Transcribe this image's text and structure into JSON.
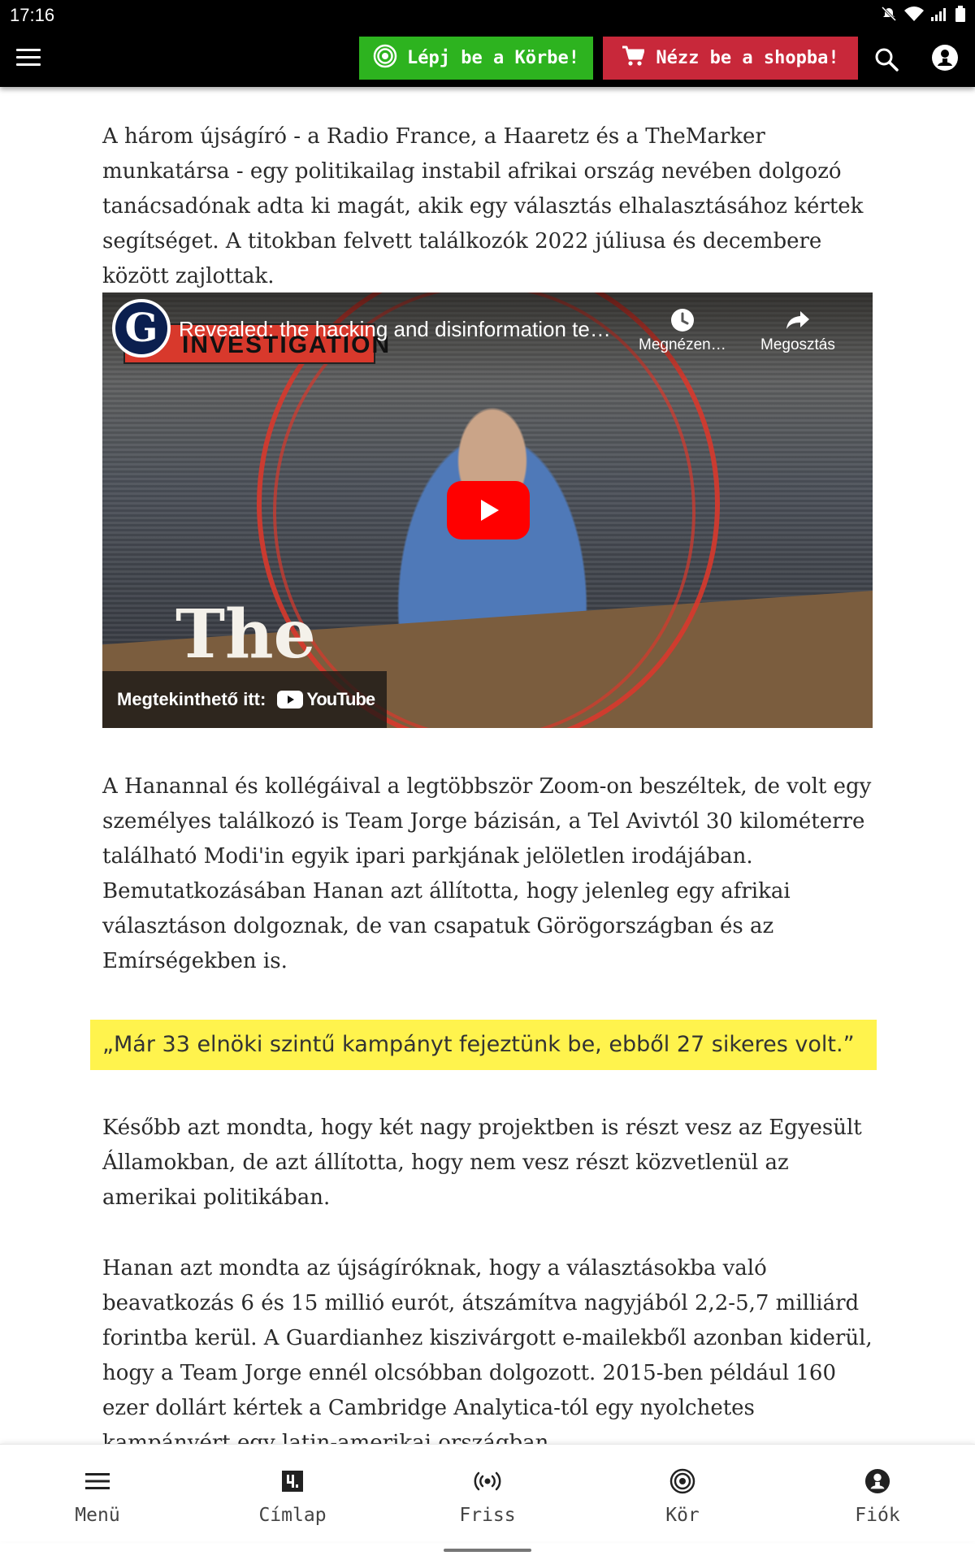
{
  "status_bar": {
    "time": "17:16"
  },
  "header": {
    "korbe_button": "Lépj be a Körbe!",
    "shop_button": "Nézz be a shopba!",
    "accent_green": "#2db31f",
    "accent_red": "#c8283a"
  },
  "article": {
    "paragraph1": "A három újságíró - a Radio France, a Haaretz és a TheMarker munkatársa - egy politikailag instabil afrikai ország nevében dolgozó tanácsadónak adta ki magát, akik egy választás elhalasztásához kértek segítséget. A titokban felvett találkozók 2022 júliusa és decembere között zajlottak.",
    "video": {
      "channel_initial": "G",
      "title": "Revealed: the hacking and disinformation te…",
      "overlay_tag": "INVESTIGATION",
      "watch_later": "Megnézen…",
      "share": "Megosztás",
      "brand_overlay": "The",
      "watch_on": "Megtekinthető itt:",
      "youtube": "YouTube"
    },
    "paragraph2": "A Hanannal és kollégáival a legtöbbször Zoom-on beszéltek, de volt egy személyes találkozó is Team Jorge bázisán, a Tel Avivtól 30 kilométerre található Modi'in egyik ipari parkjának jelöletlen irodájában. Bemutatkozásában Hanan azt állította, hogy jelenleg egy afrikai választáson dolgoznak, de van csapatuk Görögországban és az Emírségekben is.",
    "quote": "„Már 33 elnöki szintű kampányt fejeztünk be, ebből 27 sikeres volt.”",
    "paragraph3": "Később azt mondta, hogy két nagy projektben is részt vesz az Egyesült Államokban, de azt állította, hogy nem vesz részt közvetlenül az amerikai politikában.",
    "paragraph4": "Hanan azt mondta az újságíróknak, hogy a választásokba való beavatkozás 6 és 15 millió eurót, átszámítva nagyjából 2,2-5,7 milliárd forintba kerül. A Guardianhez kiszivárgott e-mailekből azonban kiderül, hogy a Team Jorge ennél olcsóbban dolgozott. 2015-ben például 160 ezer dollárt kértek a Cambridge Analytica-tól egy nyolchetes kampányért egy latin-amerikai országban."
  },
  "bottom_nav": {
    "items": [
      {
        "label": "Menü",
        "icon": "hamburger-icon"
      },
      {
        "label": "Címlap",
        "icon": "logo-icon"
      },
      {
        "label": "Friss",
        "icon": "broadcast-icon"
      },
      {
        "label": "Kör",
        "icon": "target-icon"
      },
      {
        "label": "Fiók",
        "icon": "account-icon"
      }
    ]
  }
}
